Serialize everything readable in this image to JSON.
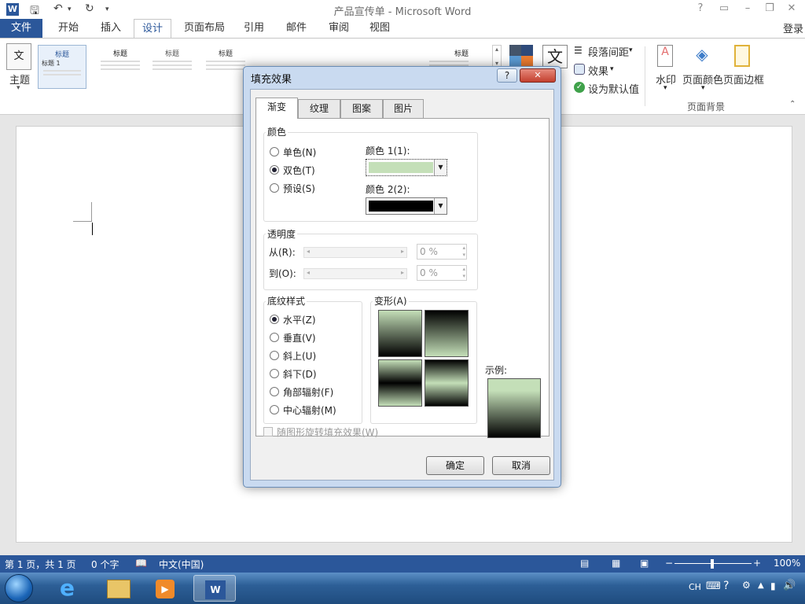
{
  "window": {
    "title": "产品宣传单 - Microsoft Word",
    "login": "登录"
  },
  "ribbon_tabs": [
    "文件",
    "开始",
    "插入",
    "设计",
    "页面布局",
    "引用",
    "邮件",
    "审阅",
    "视图"
  ],
  "ribbon": {
    "theme_label": "主题",
    "gallery": [
      "标题 1",
      "标题",
      "标题",
      "标题",
      "标题",
      "标题",
      "标题",
      "标题"
    ],
    "paragraph_spacing": "段落间距",
    "effects": "效果",
    "set_default": "设为默认值",
    "watermark": "水印",
    "page_color": "页面颜色",
    "page_border": "页面边框",
    "group_page_bg": "页面背景",
    "font_glyph": "文"
  },
  "dialog": {
    "title": "填充效果",
    "help": "?",
    "close": "✕",
    "tabs": [
      "渐变",
      "纹理",
      "图案",
      "图片"
    ],
    "colors": {
      "group": "颜色",
      "options": [
        "单色(N)",
        "双色(T)",
        "预设(S)"
      ],
      "selected": "双色(T)",
      "color1_label": "颜色 1(1):",
      "color2_label": "颜色 2(2):",
      "color1": "#c4dfb8",
      "color2": "#000000"
    },
    "transparency": {
      "group": "透明度",
      "from_label": "从(R):",
      "to_label": "到(O):",
      "from_value": "0 %",
      "to_value": "0 %"
    },
    "shading": {
      "group": "底纹样式",
      "options": [
        "水平(Z)",
        "垂直(V)",
        "斜上(U)",
        "斜下(D)",
        "角部辐射(F)",
        "中心辐射(M)"
      ],
      "selected": "水平(Z)"
    },
    "variants_label": "变形(A)",
    "sample_label": "示例:",
    "rotate_checkbox": "随图形旋转填充效果(W)",
    "ok": "确定",
    "cancel": "取消"
  },
  "statusbar": {
    "page": "第 1 页，共 1 页",
    "words": "0 个字",
    "language": "中文(中国)",
    "zoom": "100%"
  },
  "taskbar": {
    "ime": "CH"
  }
}
